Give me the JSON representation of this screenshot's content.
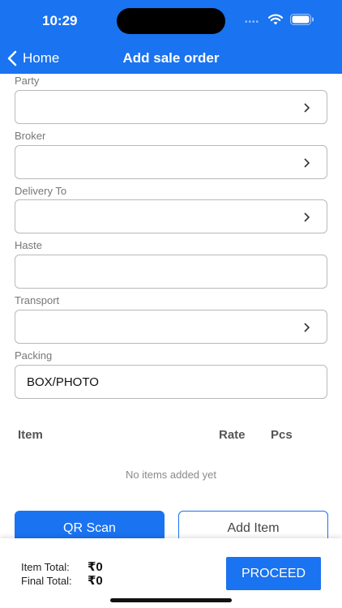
{
  "status_bar": {
    "time": "10:29"
  },
  "nav": {
    "back_label": "Home",
    "title": "Add sale order"
  },
  "fields": [
    {
      "label": "Party",
      "value": "",
      "has_chevron": true
    },
    {
      "label": "Broker",
      "value": "",
      "has_chevron": true
    },
    {
      "label": "Delivery To",
      "value": "",
      "has_chevron": true
    },
    {
      "label": "Haste",
      "value": "",
      "has_chevron": false
    },
    {
      "label": "Transport",
      "value": "",
      "has_chevron": true
    },
    {
      "label": "Packing",
      "value": "BOX/PHOTO",
      "has_chevron": false
    }
  ],
  "items_table": {
    "columns": [
      "Item",
      "Rate",
      "Pcs"
    ],
    "empty_message": "No items added yet"
  },
  "actions": {
    "qr_scan": "QR Scan",
    "add_item": "Add Item"
  },
  "footer": {
    "item_total_label": "Item Total:",
    "item_total_value": "₹0",
    "final_total_label": "Final Total:",
    "final_total_value": "₹0",
    "proceed": "PROCEED"
  },
  "colors": {
    "accent": "#1a73f0"
  },
  "icons": {
    "back": "chevron-left-icon",
    "field_chevron": "chevron-right-icon",
    "wifi": "wifi-icon",
    "battery": "battery-icon"
  }
}
